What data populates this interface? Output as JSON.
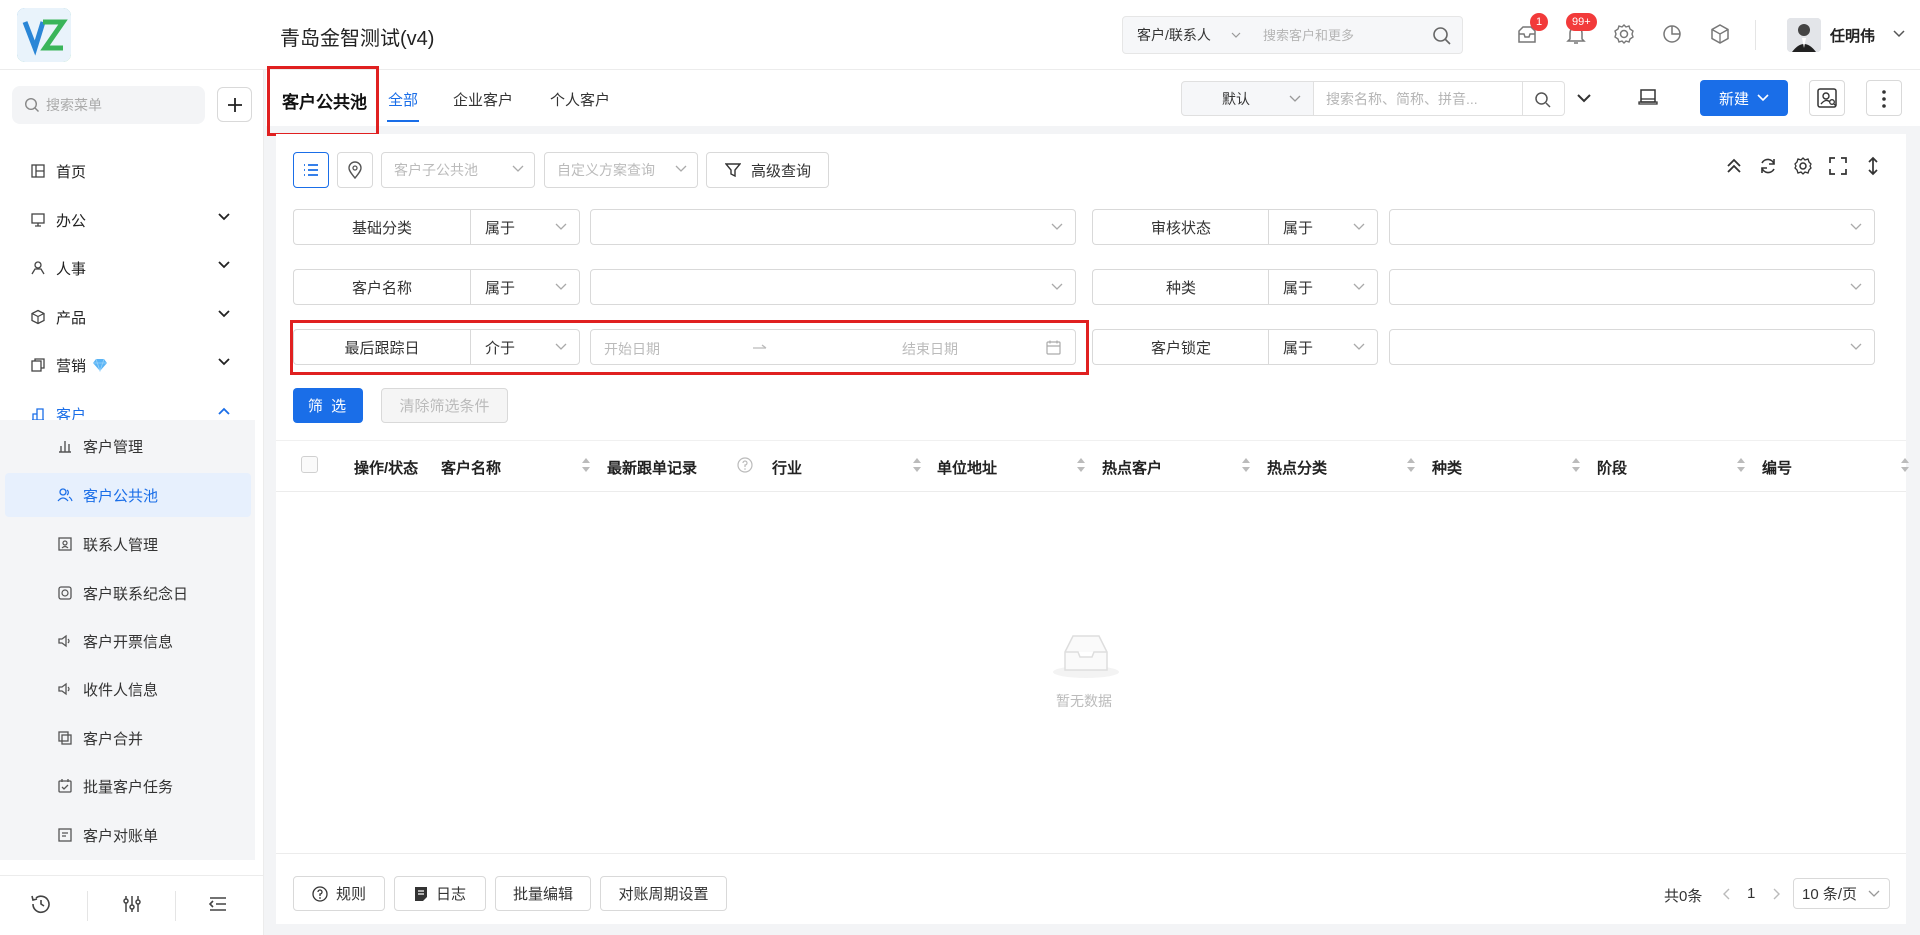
{
  "header": {
    "app_title": "青岛金智测试(v4)",
    "scope_select": "客户/联系人",
    "search_placeholder": "搜索客户和更多",
    "message_badge": "1",
    "notification_badge": "99+",
    "username": "任明伟"
  },
  "sidebar": {
    "search_placeholder": "搜索菜单",
    "items": [
      {
        "label": "首页",
        "icon": "home-icon"
      },
      {
        "label": "办公",
        "icon": "office-icon"
      },
      {
        "label": "人事",
        "icon": "hr-icon"
      },
      {
        "label": "产品",
        "icon": "product-icon"
      },
      {
        "label": "营销",
        "icon": "marketing-icon",
        "badge_icon": "diamond-icon"
      },
      {
        "label": "客户",
        "icon": "customer-icon"
      }
    ],
    "sub_items": [
      {
        "label": "客户管理"
      },
      {
        "label": "客户公共池"
      },
      {
        "label": "联系人管理"
      },
      {
        "label": "客户联系纪念日"
      },
      {
        "label": "客户开票信息"
      },
      {
        "label": "收件人信息"
      },
      {
        "label": "客户合并"
      },
      {
        "label": "批量客户任务"
      },
      {
        "label": "客户对账单"
      }
    ]
  },
  "subheader": {
    "page_title": "客户公共池",
    "tabs": [
      {
        "label": "全部",
        "active": true
      },
      {
        "label": "企业客户"
      },
      {
        "label": "个人客户"
      }
    ],
    "sort_select": "默认",
    "search_placeholder": "搜索名称、简称、拼音...",
    "new_button": "新建"
  },
  "toolbar": {
    "sub_pool_placeholder": "客户子公共池",
    "custom_query_placeholder": "自定义方案查询",
    "advanced_query": "高级查询"
  },
  "filters": {
    "rows": [
      {
        "left_label": "基础分类",
        "left_op": "属于",
        "right_label": "审核状态",
        "right_op": "属于"
      },
      {
        "left_label": "客户名称",
        "left_op": "属于",
        "right_label": "种类",
        "right_op": "属于"
      },
      {
        "left_label": "最后跟踪日",
        "left_op": "介于",
        "right_label": "客户锁定",
        "right_op": "属于"
      }
    ],
    "date_start_placeholder": "开始日期",
    "date_end_placeholder": "结束日期",
    "filter_button": "筛 选",
    "clear_button": "清除筛选条件"
  },
  "table": {
    "columns": [
      "操作/状态",
      "客户名称",
      "最新跟单记录",
      "行业",
      "单位地址",
      "热点客户",
      "热点分类",
      "种类",
      "阶段",
      "编号"
    ],
    "rows": [],
    "empty_text": "暂无数据"
  },
  "footer": {
    "buttons": [
      "规则",
      "日志",
      "批量编辑",
      "对账周期设置"
    ],
    "total": "共0条",
    "current_page": "1",
    "page_size": "10 条/页"
  },
  "colors": {
    "primary": "#1a6ee8",
    "highlight_border": "#e02020",
    "badge": "#f23a3a"
  }
}
